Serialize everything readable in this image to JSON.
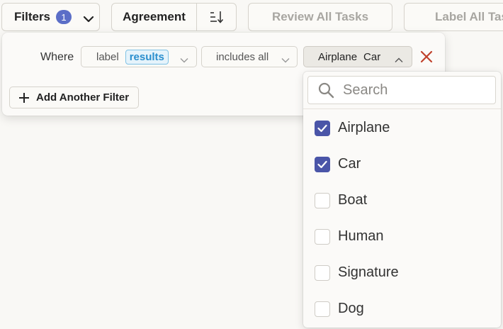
{
  "toolbar": {
    "filters_label": "Filters",
    "filters_count": "1",
    "agreement_label": "Agreement",
    "review_label": "Review All Tasks",
    "label_all_label": "Label All Tas"
  },
  "filter": {
    "where_label": "Where",
    "field_prefix": "label",
    "field_tag": "results",
    "operator": "includes all",
    "selected_values": [
      "Airplane",
      "Car"
    ],
    "add_filter_label": "Add Another Filter"
  },
  "dropdown": {
    "search_placeholder": "Search",
    "options": [
      {
        "label": "Airplane",
        "checked": true
      },
      {
        "label": "Car",
        "checked": true
      },
      {
        "label": "Boat",
        "checked": false
      },
      {
        "label": "Human",
        "checked": false
      },
      {
        "label": "Signature",
        "checked": false
      },
      {
        "label": "Dog",
        "checked": false
      }
    ]
  },
  "colors": {
    "accent": "#4a55a8",
    "badge": "#5b6ec7",
    "remove": "#c0412c",
    "tag_text": "#2b8fce"
  }
}
